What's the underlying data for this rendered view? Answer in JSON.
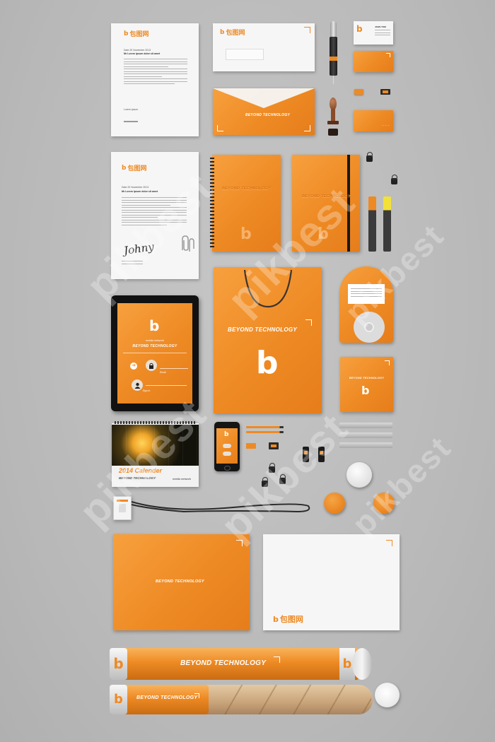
{
  "brand": {
    "tagline": "BEYOND TECHNOLOGY",
    "logo_glyph": "b",
    "logo_cn": "包图网",
    "network": "media network",
    "colors": {
      "accent": "#ee8a24",
      "paper": "#f6f6f6",
      "background": "#bcbcbc",
      "dark": "#1c1c1c"
    }
  },
  "letterhead": {
    "date": "Date 20 November 2013",
    "subject": "Mr Lorem ipsum dolor sit amet",
    "signoff": "Lorem ipsum",
    "signature": "Johny"
  },
  "business_card": {
    "name": "JOHN TOM"
  },
  "tablet": {
    "field1": "Email",
    "field2": "Password",
    "sign_in": "Sign in"
  },
  "calendar": {
    "year_title": "2014 Calender",
    "subtitle": "BEYOND TECHNOLOGY"
  },
  "watermark": {
    "text": "pikbest"
  },
  "icons": [
    "pen-icon",
    "stamp-icon",
    "binder-clip-icon",
    "paperclip-icon",
    "lock-icon",
    "user-icon",
    "arrow-icon",
    "cd-icon",
    "badge-icon",
    "usb-icon",
    "ruler-icon",
    "lanyard-icon",
    "phone-icon"
  ]
}
